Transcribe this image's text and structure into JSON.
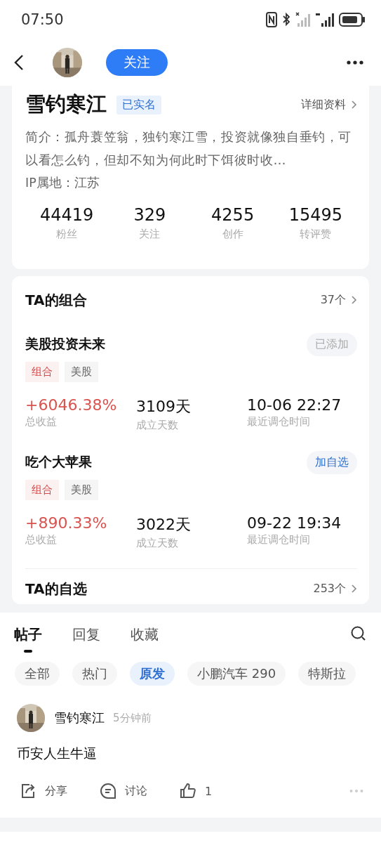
{
  "status_bar": {
    "time": "07:50"
  },
  "header": {
    "follow_button": "关注"
  },
  "profile": {
    "name": "雪钓寒江",
    "verified_badge": "已实名",
    "details_link": "详细资料",
    "bio": "简介：孤舟蓑笠翁，独钓寒江雪，投资就像独自垂钓，可以看怎么钓，但却不知为何此时下饵彼时收…",
    "ip_location": "IP属地：江苏",
    "stats": [
      {
        "value": "44419",
        "label": "粉丝"
      },
      {
        "value": "329",
        "label": "关注"
      },
      {
        "value": "4255",
        "label": "创作"
      },
      {
        "value": "15495",
        "label": "转评赞"
      }
    ]
  },
  "portfolios": {
    "title": "TA的组合",
    "count": "37个",
    "items": [
      {
        "name": "美股投资未来",
        "action": {
          "label": "已添加",
          "added": true
        },
        "tags": [
          {
            "label": "组合",
            "kind": "type"
          },
          {
            "label": "美股",
            "kind": "market"
          }
        ],
        "metrics": [
          {
            "value": "+6046.38%",
            "label": "总收益",
            "kind": "return"
          },
          {
            "value": "3109天",
            "label": "成立天数",
            "kind": "plain"
          },
          {
            "value": "10-06 22:27",
            "label": "最近调仓时间",
            "kind": "plain"
          }
        ]
      },
      {
        "name": "吃个大苹果",
        "action": {
          "label": "加自选",
          "added": false
        },
        "tags": [
          {
            "label": "组合",
            "kind": "type"
          },
          {
            "label": "美股",
            "kind": "market"
          }
        ],
        "metrics": [
          {
            "value": "+890.33%",
            "label": "总收益",
            "kind": "return"
          },
          {
            "value": "3022天",
            "label": "成立天数",
            "kind": "plain"
          },
          {
            "value": "09-22 19:34",
            "label": "最近调仓时间",
            "kind": "plain"
          }
        ]
      }
    ]
  },
  "watchlist": {
    "title": "TA的自选",
    "count": "253个"
  },
  "tabs": [
    {
      "label": "帖子",
      "selected": true
    },
    {
      "label": "回复",
      "selected": false
    },
    {
      "label": "收藏",
      "selected": false
    }
  ],
  "filters": [
    {
      "label": "全部",
      "selected": false
    },
    {
      "label": "热门",
      "selected": false
    },
    {
      "label": "原发",
      "selected": true
    },
    {
      "label": "小鹏汽车 290",
      "selected": false
    },
    {
      "label": "特斯拉",
      "selected": false
    }
  ],
  "post": {
    "author": "雪钓寒江",
    "time": "5分钟前",
    "text": "币安人生牛逼",
    "actions": [
      {
        "kind": "share",
        "label": "分享"
      },
      {
        "kind": "discuss",
        "label": "讨论"
      },
      {
        "kind": "like",
        "label": "1"
      }
    ]
  }
}
